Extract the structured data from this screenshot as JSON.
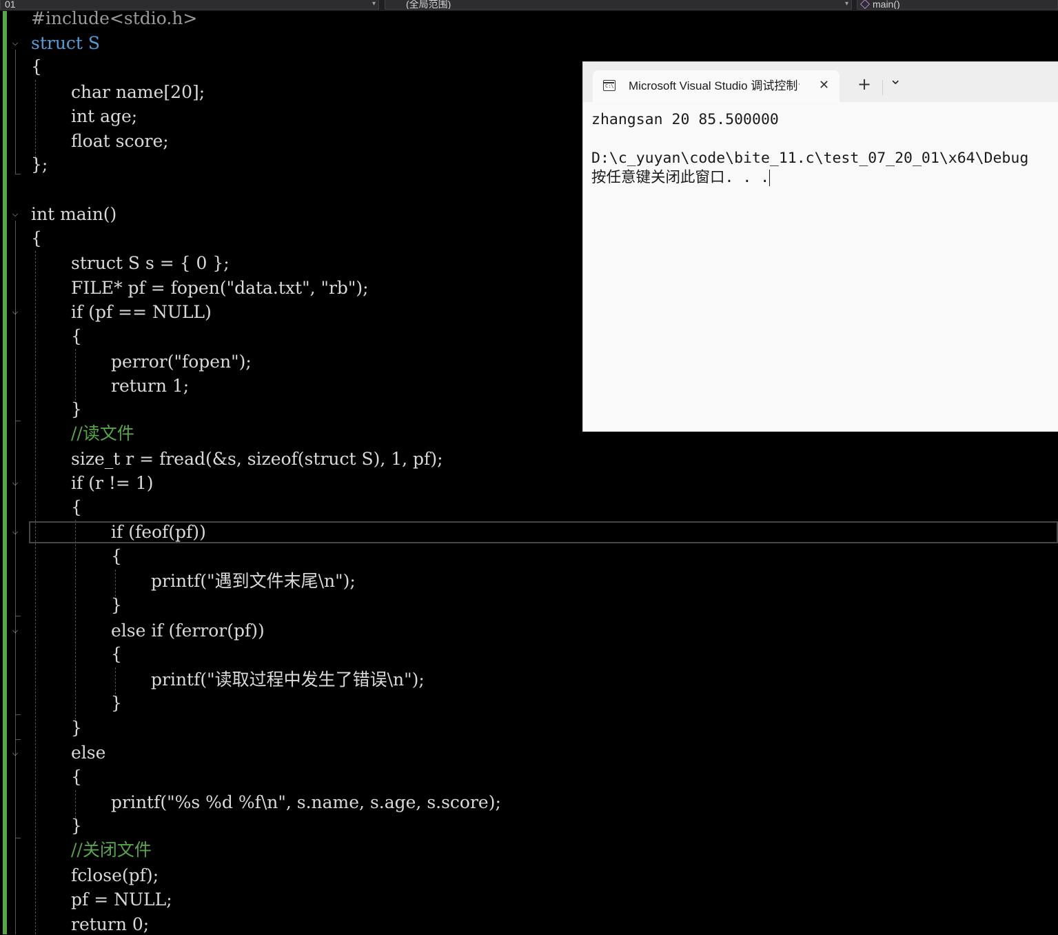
{
  "navbar": {
    "project": "01",
    "scope": "(全局范围)",
    "function": "main()"
  },
  "code_lines": [
    "#include<stdio.h>",
    "struct S",
    "{",
    "char name[20];",
    "int age;",
    "float score;",
    "};",
    "int main()",
    "{",
    "struct S s = { 0 };",
    "FILE* pf = fopen(\"data.txt\", \"rb\");",
    "if (pf == NULL)",
    "{",
    "perror(\"fopen\");",
    "return 1;",
    "}",
    "//读文件",
    "size_t r = fread(&s, sizeof(struct S), 1, pf);",
    "if (r != 1)",
    "{",
    "if (feof(pf))",
    "{",
    "printf(\"遇到文件末尾\\n\");",
    "}",
    "else if (ferror(pf))",
    "{",
    "printf(\"读取过程中发生了错误\\n\");",
    "}",
    "}",
    "else",
    "{",
    "printf(\"%s %d %f\\n\", s.name, s.age, s.score);",
    "}",
    "//关闭文件",
    "fclose(pf);",
    "pf = NULL;",
    "return 0;"
  ],
  "console": {
    "tab_title": "Microsoft Visual Studio 调试控制台",
    "icon_label": "C:\\",
    "new_tab_label": "+",
    "dropdown_label": "⌄",
    "close_label": "✕",
    "output_line1": "zhangsan 20 85.500000",
    "output_line2": "D:\\c_yuyan\\code\\bite_11.c\\test_07_20_01\\x64\\Debug",
    "output_line3": "按任意键关闭此窗口. . ."
  }
}
